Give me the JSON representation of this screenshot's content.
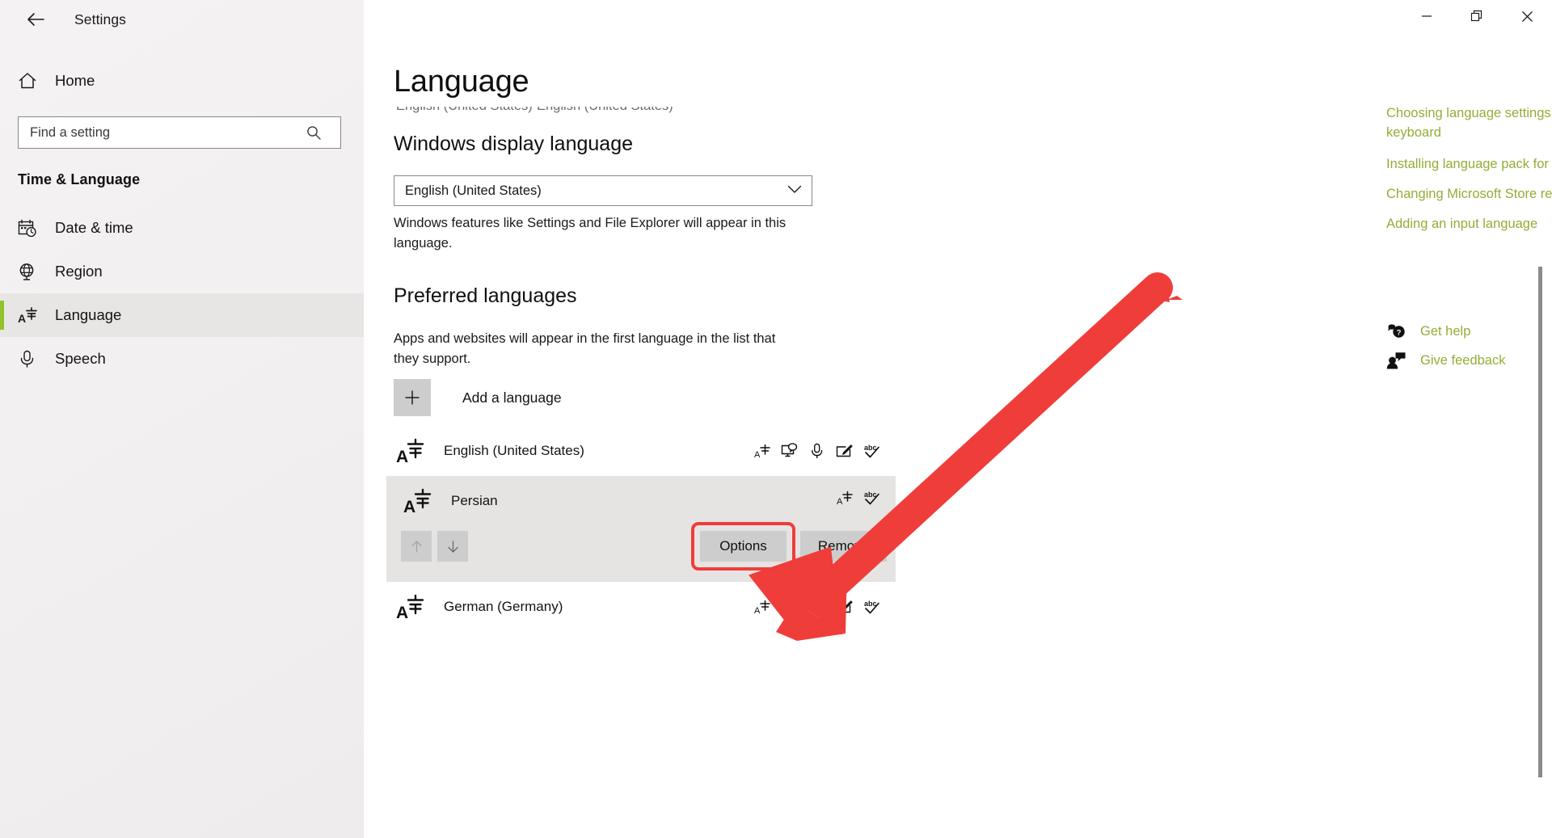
{
  "window": {
    "app_title": "Settings",
    "back_icon": "back-arrow-icon",
    "minimize_label": "—",
    "maximize_label": "restore-icon",
    "close_label": "✕"
  },
  "accent_color": "#8fc327",
  "link_color": "#93ad36",
  "annotation_color": "#ef3d3a",
  "sidebar": {
    "home_label": "Home",
    "home_icon": "home-icon",
    "search": {
      "placeholder": "Find a setting",
      "value": "",
      "icon": "search-icon"
    },
    "category_title": "Time & Language",
    "items": [
      {
        "label": "Date & time",
        "icon": "calendar-clock-icon",
        "selected": false
      },
      {
        "label": "Region",
        "icon": "globe-icon",
        "selected": false
      },
      {
        "label": "Language",
        "icon": "language-icon",
        "selected": true
      },
      {
        "label": "Speech",
        "icon": "microphone-icon",
        "selected": false
      }
    ]
  },
  "main": {
    "page_title": "Language",
    "clipped_row": {
      "left_text": "English (United States)",
      "right_text": "English (United States)"
    },
    "display_language": {
      "heading": "Windows display language",
      "selected": "English (United States)",
      "chevron_icon": "chevron-down-icon",
      "description": "Windows features like Settings and File Explorer will appear in this language."
    },
    "preferred_languages": {
      "heading": "Preferred languages",
      "description": "Apps and websites will appear in the first language in the list that they support.",
      "add_language": {
        "label": "Add a language",
        "icon": "plus-icon"
      },
      "rows": [
        {
          "name": "English (United States)",
          "icon": "language-icon",
          "expanded": false,
          "feature_icons": [
            "language-pack-icon",
            "display-language-icon",
            "speech-icon",
            "handwriting-icon",
            "spellcheck-icon"
          ]
        },
        {
          "name": "Persian",
          "icon": "language-icon",
          "expanded": true,
          "feature_icons": [
            "language-pack-icon",
            "spellcheck-icon"
          ],
          "move_up_label": "move-up",
          "move_down_label": "move-down",
          "move_up_enabled": false,
          "move_down_enabled": true,
          "options_label": "Options",
          "remove_label": "Remove",
          "options_highlighted": true
        },
        {
          "name": "German (Germany)",
          "icon": "language-icon",
          "expanded": false,
          "feature_icons": [
            "language-pack-icon",
            "display-language-icon",
            "speech-icon",
            "handwriting-icon",
            "spellcheck-icon"
          ]
        }
      ]
    }
  },
  "rail": {
    "links": [
      "Choosing language settings for your keyboard",
      "Installing language pack for speech",
      "Changing Microsoft Store region",
      "Adding an input language"
    ],
    "support": [
      {
        "label": "Get help",
        "icon": "help-icon"
      },
      {
        "label": "Give feedback",
        "icon": "feedback-icon"
      }
    ]
  }
}
